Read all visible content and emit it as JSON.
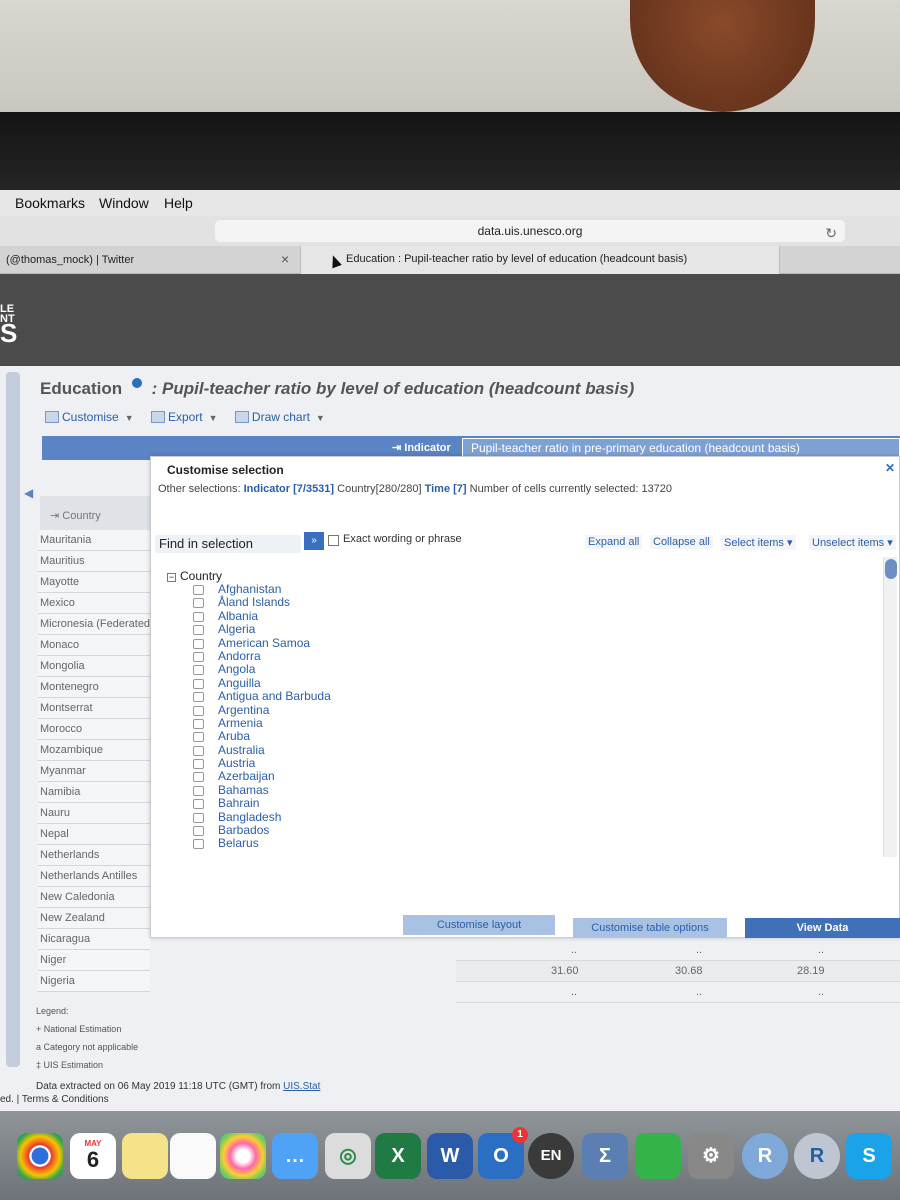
{
  "menubar": {
    "items": [
      "Bookmarks",
      "Window",
      "Help"
    ]
  },
  "browser": {
    "url": "data.uis.unesco.org",
    "tabs": [
      {
        "label": "(@thomas_mock) | Twitter"
      },
      {
        "label": "Education : Pupil-teacher ratio by level of education (headcount basis)"
      }
    ]
  },
  "site": {
    "logo_top": "LE\nNT",
    "logo_big": "S"
  },
  "page": {
    "title_main": "Education",
    "title_sub": ": Pupil-teacher ratio by level of education (headcount basis)",
    "actions": [
      "Customise",
      "Export",
      "Draw chart"
    ],
    "indicator_label": "Indicator",
    "indicator_value": "Pupil-teacher ratio in pre-primary education (headcount basis)",
    "country_header": "Country",
    "countries": [
      "Mauritania",
      "Mauritius",
      "Mayotte",
      "Mexico",
      "Micronesia (Federated States of)",
      "Monaco",
      "Mongolia",
      "Montenegro",
      "Montserrat",
      "Morocco",
      "Mozambique",
      "Myanmar",
      "Namibia",
      "Nauru",
      "Nepal",
      "Netherlands",
      "Netherlands Antilles",
      "New Caledonia",
      "New Zealand",
      "Nicaragua",
      "Niger",
      "Nigeria"
    ],
    "data_rows": [
      {
        "c1": "..",
        "c2": "..",
        "c3": ".."
      },
      {
        "c1": "31.60",
        "c2": "30.68",
        "c3": "28.19"
      },
      {
        "c1": "..",
        "c2": "..",
        "c3": ".."
      }
    ],
    "legend_title": "Legend:",
    "legend": [
      {
        "sym": "+",
        "text": "National Estimation"
      },
      {
        "sym": "a",
        "text": "Category not applicable"
      },
      {
        "sym": "‡",
        "text": "UIS Estimation"
      }
    ],
    "extracted": "Data extracted on 06 May 2019 11:18 UTC (GMT) from",
    "extracted_link": "UIS.Stat",
    "terms": "ed. | Terms & Conditions"
  },
  "modal": {
    "title": "Customise selection",
    "other_label": "Other selections:",
    "other_indicator": "Indicator [7/3531]",
    "other_country": "Country[280/280]",
    "other_time": "Time [7]",
    "cells_selected": "Number of cells currently selected: 13720",
    "find_placeholder": "Find in selection",
    "go_label": "»",
    "exact_label": "Exact wording or phrase",
    "expand_all": "Expand all",
    "collapse_all": "Collapse all",
    "select_items": "Select items ▾",
    "unselect_items": "Unselect items ▾",
    "tree_root": "Country",
    "tree_items": [
      "Afghanistan",
      "Åland Islands",
      "Albania",
      "Algeria",
      "American Samoa",
      "Andorra",
      "Angola",
      "Anguilla",
      "Antigua and Barbuda",
      "Argentina",
      "Armenia",
      "Aruba",
      "Australia",
      "Austria",
      "Azerbaijan",
      "Bahamas",
      "Bahrain",
      "Bangladesh",
      "Barbados",
      "Belarus"
    ],
    "buttons": [
      "Customise layout",
      "Customise table options",
      "View Data"
    ]
  },
  "dock": {
    "calendar_month": "MAY",
    "calendar_day": "6",
    "icons": [
      "chrome-icon",
      "calendar-icon",
      "notes-icon",
      "reminders-icon",
      "photos-icon",
      "messages-icon",
      "excel-icon",
      "word-icon",
      "outlook-icon",
      "en-icon",
      "sigma-icon",
      "facetime-icon",
      "preferences-icon",
      "rstudio-icon",
      "r-icon",
      "skype-icon"
    ],
    "outlook_badge": "1"
  },
  "colors": {
    "accent": "#3f70b8",
    "link": "#2a5fa8",
    "header": "#4b4b4b"
  }
}
